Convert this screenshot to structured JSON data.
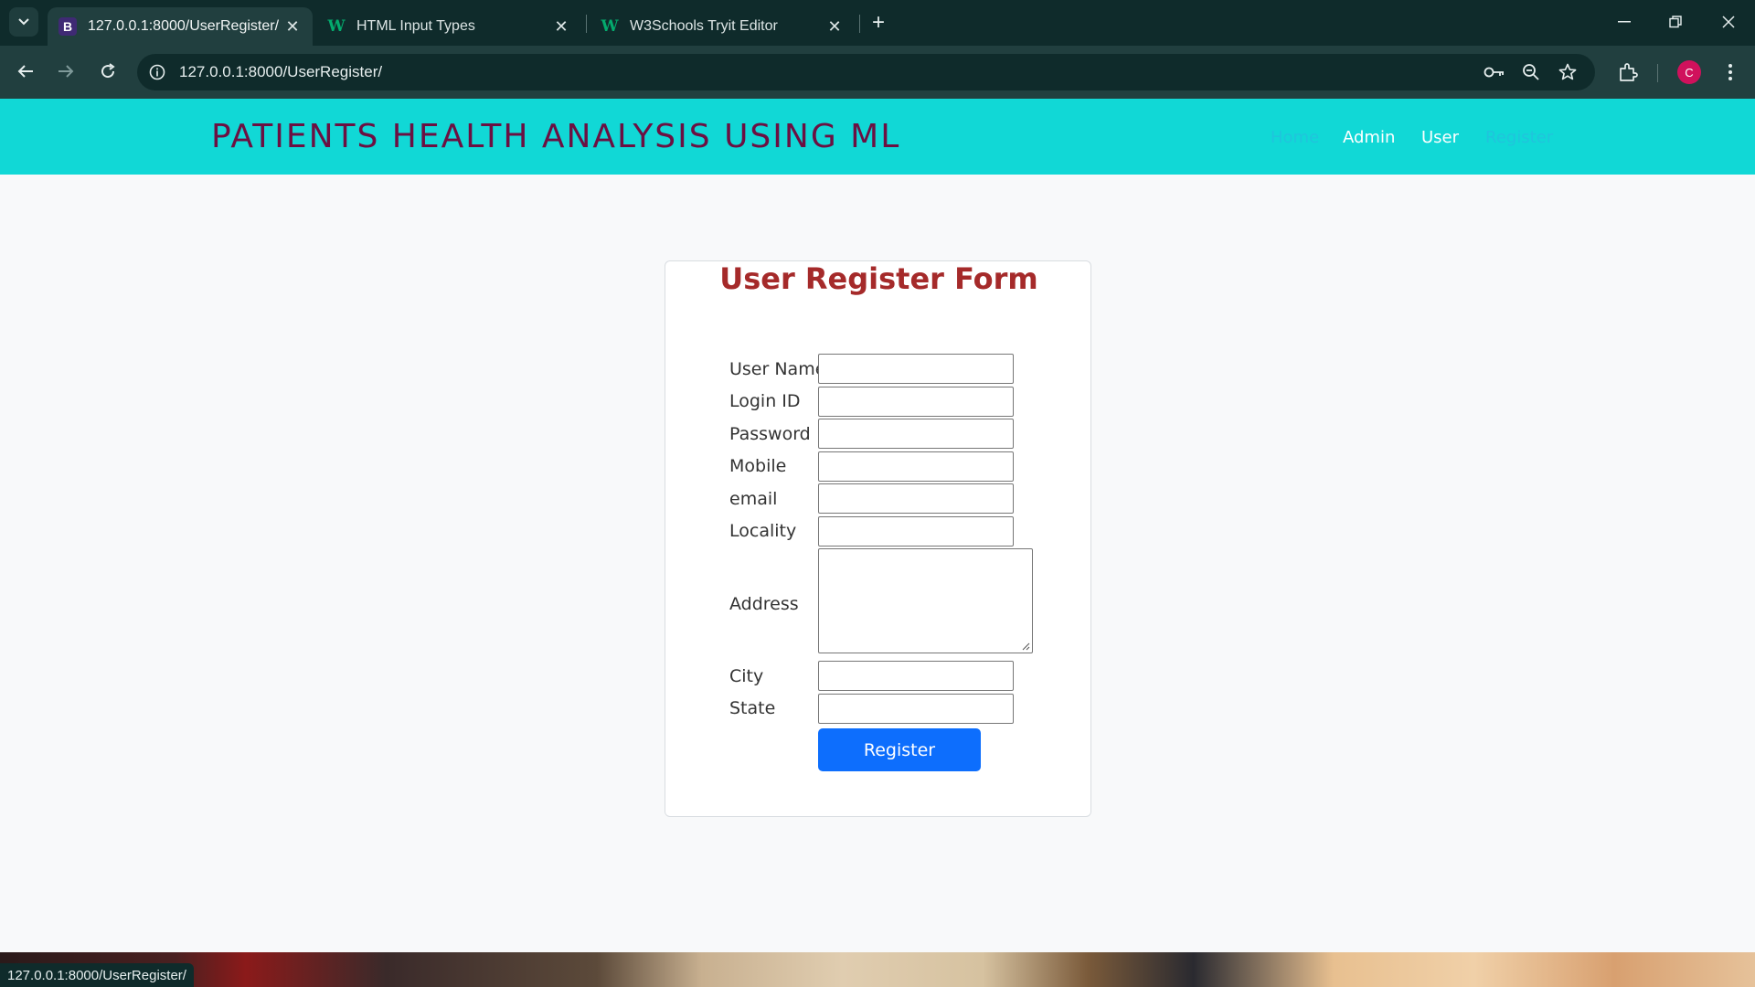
{
  "browser": {
    "tabs": [
      {
        "title": "127.0.0.1:8000/UserRegister/",
        "favicon": "B",
        "active": true
      },
      {
        "title": "HTML Input Types",
        "favicon": "W",
        "active": false
      },
      {
        "title": "W3Schools Tryit Editor",
        "favicon": "W",
        "active": false
      }
    ],
    "url": "127.0.0.1:8000/UserRegister/",
    "profile_initial": "C",
    "status_url": "127.0.0.1:8000/UserRegister/"
  },
  "site": {
    "title": "PATIENTS HEALTH ANALYSIS USING ML",
    "nav": [
      {
        "label": "Home"
      },
      {
        "label": "Admin"
      },
      {
        "label": "User"
      },
      {
        "label": "Register"
      }
    ]
  },
  "form": {
    "title": "User Register Form",
    "fields": [
      {
        "label": "User Name",
        "value": ""
      },
      {
        "label": "Login ID",
        "value": ""
      },
      {
        "label": "Password",
        "value": ""
      },
      {
        "label": "Mobile",
        "value": ""
      },
      {
        "label": "email",
        "value": ""
      },
      {
        "label": "Locality",
        "value": ""
      },
      {
        "label": "Address",
        "value": ""
      },
      {
        "label": "City",
        "value": ""
      },
      {
        "label": "State",
        "value": ""
      }
    ],
    "submit_label": "Register"
  },
  "colors": {
    "header_bg": "#11d8d6",
    "site_title": "#6b1042",
    "form_title": "#a52a2a",
    "button_bg": "#0d6efd"
  }
}
